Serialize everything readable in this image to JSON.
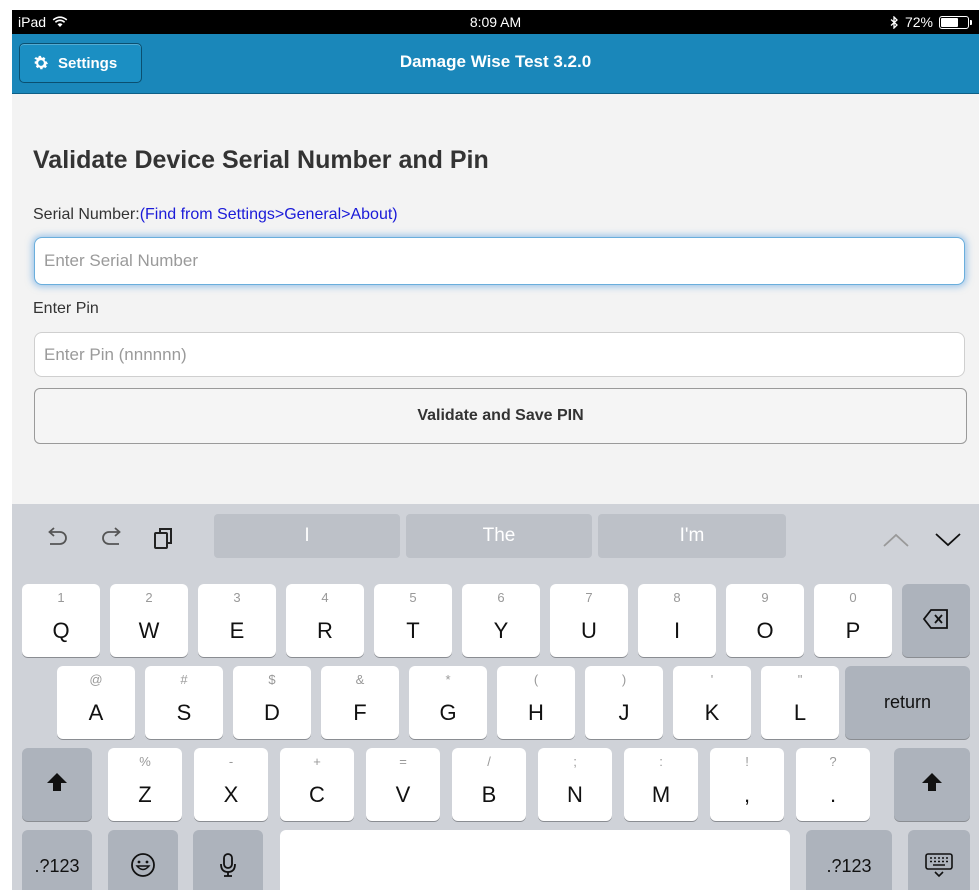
{
  "status_bar": {
    "device": "iPad",
    "time": "8:09 AM",
    "battery_text": "72%",
    "battery_level": 0.72
  },
  "nav": {
    "settings_label": "Settings",
    "title": "Damage Wise Test 3.2.0"
  },
  "form": {
    "heading": "Validate Device Serial Number and Pin",
    "serial_label": "Serial Number:",
    "serial_link": "(Find from Settings>General>About)",
    "serial_placeholder": "Enter Serial Number",
    "pin_label": "Enter Pin",
    "pin_placeholder": "Enter Pin (nnnnnn)",
    "validate_button": "Validate and Save PIN"
  },
  "keyboard": {
    "suggestions": [
      "I",
      "The",
      "I'm"
    ],
    "row1": [
      {
        "hint": "1",
        "key": "Q"
      },
      {
        "hint": "2",
        "key": "W"
      },
      {
        "hint": "3",
        "key": "E"
      },
      {
        "hint": "4",
        "key": "R"
      },
      {
        "hint": "5",
        "key": "T"
      },
      {
        "hint": "6",
        "key": "Y"
      },
      {
        "hint": "7",
        "key": "U"
      },
      {
        "hint": "8",
        "key": "I"
      },
      {
        "hint": "9",
        "key": "O"
      },
      {
        "hint": "0",
        "key": "P"
      }
    ],
    "row2": [
      {
        "hint": "@",
        "key": "A"
      },
      {
        "hint": "#",
        "key": "S"
      },
      {
        "hint": "$",
        "key": "D"
      },
      {
        "hint": "&",
        "key": "F"
      },
      {
        "hint": "*",
        "key": "G"
      },
      {
        "hint": "(",
        "key": "H"
      },
      {
        "hint": ")",
        "key": "J"
      },
      {
        "hint": "'",
        "key": "K"
      },
      {
        "hint": "\"",
        "key": "L"
      }
    ],
    "return_label": "return",
    "row3": [
      {
        "hint": "%",
        "key": "Z"
      },
      {
        "hint": "-",
        "key": "X"
      },
      {
        "hint": "+",
        "key": "C"
      },
      {
        "hint": "=",
        "key": "V"
      },
      {
        "hint": "/",
        "key": "B"
      },
      {
        "hint": ";",
        "key": "N"
      },
      {
        "hint": ":",
        "key": "M"
      },
      {
        "hint": "!",
        "key": ","
      },
      {
        "hint": "?",
        "key": "."
      }
    ],
    "numbers_label": ".?123"
  },
  "icons": {
    "gear": "gear-icon",
    "undo": "undo-icon",
    "redo": "redo-icon",
    "paste": "paste-icon",
    "up": "chevron-up-icon",
    "down": "chevron-down-icon",
    "delete": "backspace-icon",
    "shift": "shift-icon",
    "emoji": "emoji-icon",
    "mic": "microphone-icon",
    "hide_keyboard": "keyboard-dismiss-icon"
  },
  "colors": {
    "nav_bar": "#1a87ba",
    "link": "#1a1ad8",
    "keyboard_bg": "#cfd2d8"
  }
}
